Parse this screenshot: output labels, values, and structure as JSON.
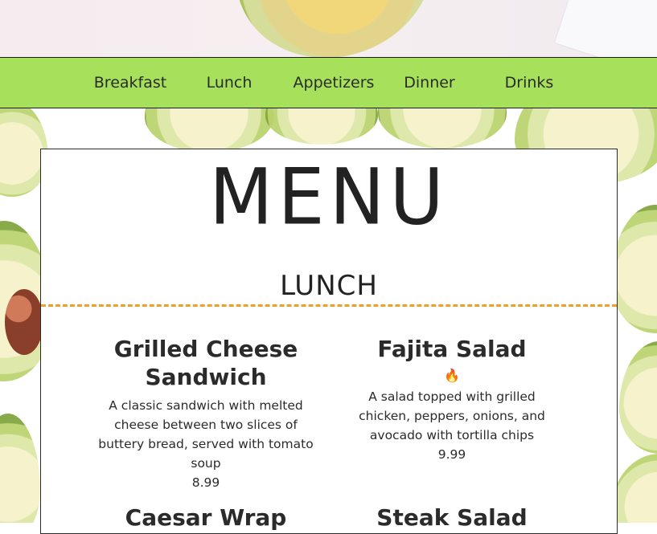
{
  "nav": {
    "items": [
      {
        "label": "Breakfast"
      },
      {
        "label": "Lunch"
      },
      {
        "label": "Appetizers"
      },
      {
        "label": "Dinner"
      },
      {
        "label": "Drinks"
      }
    ]
  },
  "menu": {
    "title": "MENU",
    "section_title": "LUNCH",
    "items": [
      {
        "name": "Grilled Cheese Sandwich",
        "description": "A classic sandwich with melted cheese between two slices of buttery bread, served with tomato soup",
        "price": "8.99",
        "spicy": false
      },
      {
        "name": "Fajita Salad",
        "description": "A salad topped with grilled chicken, peppers, onions, and avocado with tortilla chips",
        "price": "9.99",
        "spicy": true,
        "spicy_icon": "🔥"
      },
      {
        "name": "Caesar Wrap"
      },
      {
        "name": "Steak Salad"
      }
    ]
  },
  "colors": {
    "nav_bg": "#a7e15b",
    "divider": "#f0a02a",
    "text": "#2b2b2b"
  }
}
